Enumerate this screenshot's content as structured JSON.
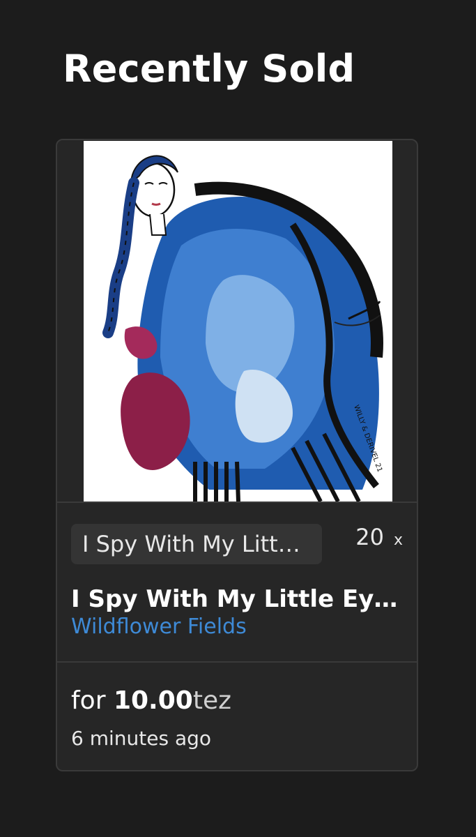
{
  "header": {
    "title": "Recently Sold"
  },
  "sale_card": {
    "artwork_alt": "Illustration of a woman with a long braid wearing a blue painted coat",
    "collection_chip": "I Spy With My Litt…",
    "edition_count": "20",
    "edition_suffix": "x",
    "token_title": "I Spy With My Little Ey…",
    "artist_name": "Wildflower Fields",
    "price_prefix": "for",
    "price_amount": "10.00",
    "price_currency": "tez",
    "time_ago": "6 minutes ago"
  },
  "colors": {
    "background": "#1c1c1c",
    "card": "#262626",
    "chip": "#343434",
    "link": "#3e8ad6"
  }
}
